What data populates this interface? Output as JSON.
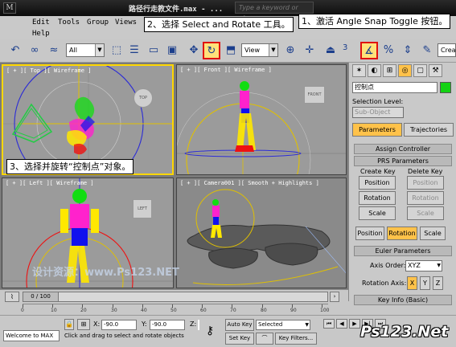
{
  "titlebar": {
    "title": "路径行走教文件.max - ...",
    "search_placeholder": "Type a keyword or phrase"
  },
  "menu": [
    "Edit",
    "Tools",
    "Group",
    "Views",
    "Help"
  ],
  "toolbar": {
    "selection_filter": "All",
    "ref_coord": "View",
    "angle_snap_value": "3",
    "named_selection": "Crea"
  },
  "callouts": {
    "c1": "1、激活 Angle Snap Toggle 按钮。",
    "c2": "2、选择 Select and Rotate 工具。",
    "c3": "3、选择并旋转“控制点”对象。"
  },
  "viewports": {
    "top": {
      "label": "[ + ][ Top ][ Wireframe ]",
      "cube": "TOP"
    },
    "front": {
      "label": "[ + ][ Front ][ Wireframe ]",
      "cube": "FRONT"
    },
    "left": {
      "label": "[ + ][ Left ][ Wireframe ]",
      "cube": "LEFT"
    },
    "persp": {
      "label": "[ + ][ Camera001 ][ Smooth + Highlights ]"
    },
    "watermark": "设计资源：www.Ps123.NET"
  },
  "command_panel": {
    "object_name": "控制点",
    "object_color": "#14d214",
    "selection_level_label": "Selection Level:",
    "sub_object": "Sub-Object",
    "tab_parameters": "Parameters",
    "tab_trajectories": "Trajectories",
    "assign_controller": "Assign Controller",
    "prs_parameters": "PRS Parameters",
    "create_key": "Create Key",
    "delete_key": "Delete Key",
    "position": "Position",
    "rotation": "Rotation",
    "scale": "Scale",
    "euler_parameters": "Euler Parameters",
    "axis_order_label": "Axis Order:",
    "axis_order_value": "XYZ",
    "rotation_axis_label": "Rotation Axis:",
    "axis_x": "X",
    "axis_y": "Y",
    "axis_z": "Z",
    "key_info": "Key Info (Basic)"
  },
  "trackbar": {
    "frame_display": "0 / 100",
    "ticks": [
      "0",
      "10",
      "20",
      "30",
      "40",
      "50",
      "60",
      "70",
      "80",
      "90",
      "100"
    ]
  },
  "statusbar": {
    "maxscript": "Welcome to MAX",
    "x_label": "X:",
    "x_value": "-90.0",
    "y_label": "Y:",
    "y_value": "-90.0",
    "z_label": "Z:",
    "auto_key": "Auto Key",
    "set_key": "Set Key",
    "selected": "Selected",
    "key_filters": "Key Filters...",
    "prompt": "Click and drag to select and rotate objects",
    "brand": "Ps123.Net"
  }
}
